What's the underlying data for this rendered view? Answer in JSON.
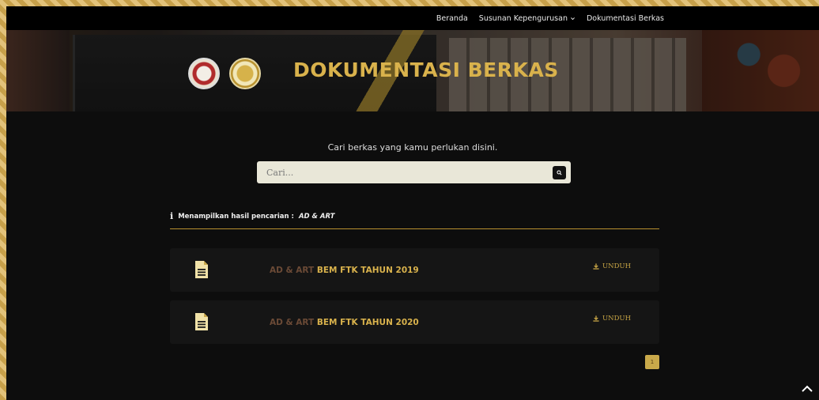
{
  "navbar": {
    "items": [
      {
        "label": "Beranda"
      },
      {
        "label": "Susunan Kepengurusan"
      },
      {
        "label": "Dokumentasi Berkas"
      }
    ]
  },
  "hero": {
    "title": "DOKUMENTASI BERKAS"
  },
  "search": {
    "caption": "Cari berkas yang kamu perlukan disini.",
    "placeholder": "Cari...",
    "value": ""
  },
  "results": {
    "header_label": "Menampilkan hasil pencarian :",
    "query": "AD & ART",
    "items": [
      {
        "title_prefix": "AD & ART",
        "title_main": "BEM FTK TAHUN 2019",
        "download_label": "UNDUH"
      },
      {
        "title_prefix": "AD & ART",
        "title_main": "BEM FTK TAHUN 2020",
        "download_label": "UNDUH"
      }
    ]
  },
  "pagination": {
    "current_page": "1"
  },
  "colors": {
    "accent": "#d9b24c",
    "background": "#0d0d0d",
    "card": "#151515",
    "divider": "#b8902f"
  },
  "icons": {
    "info": "info-icon",
    "search": "search-icon",
    "document": "document-icon",
    "download": "download-icon",
    "chevron": "chevron-down-icon",
    "scroll_top": "chevron-up-icon"
  }
}
